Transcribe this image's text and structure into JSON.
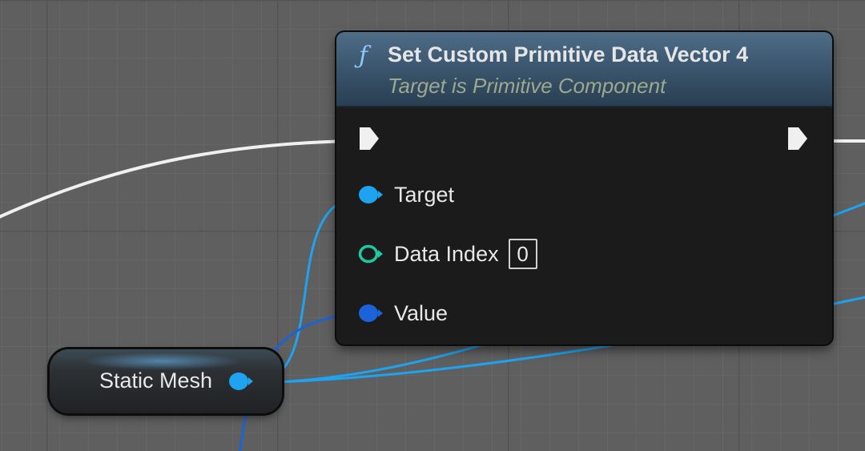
{
  "function_node": {
    "icon": "function-icon",
    "icon_glyph": "ƒ",
    "title": "Set Custom Primitive Data Vector 4",
    "subtitle": "Target is Primitive Component",
    "inputs": [
      {
        "label": "Target",
        "pin": "object-pin-icon",
        "color": "#1fa3f0"
      },
      {
        "label": "Data Index",
        "pin": "integer-pin-icon",
        "color": "#1fc8a0",
        "value": "0"
      },
      {
        "label": "Value",
        "pin": "vector4-pin-icon",
        "color": "#1a63d8"
      }
    ]
  },
  "mesh_node": {
    "label": "Static Mesh",
    "pin": "object-pin-icon",
    "color": "#1fa3f0"
  },
  "colors": {
    "exec_wire": "#f0f0f0",
    "object_wire": "#1fa3f0",
    "vector_wire": "#1a63d8"
  }
}
